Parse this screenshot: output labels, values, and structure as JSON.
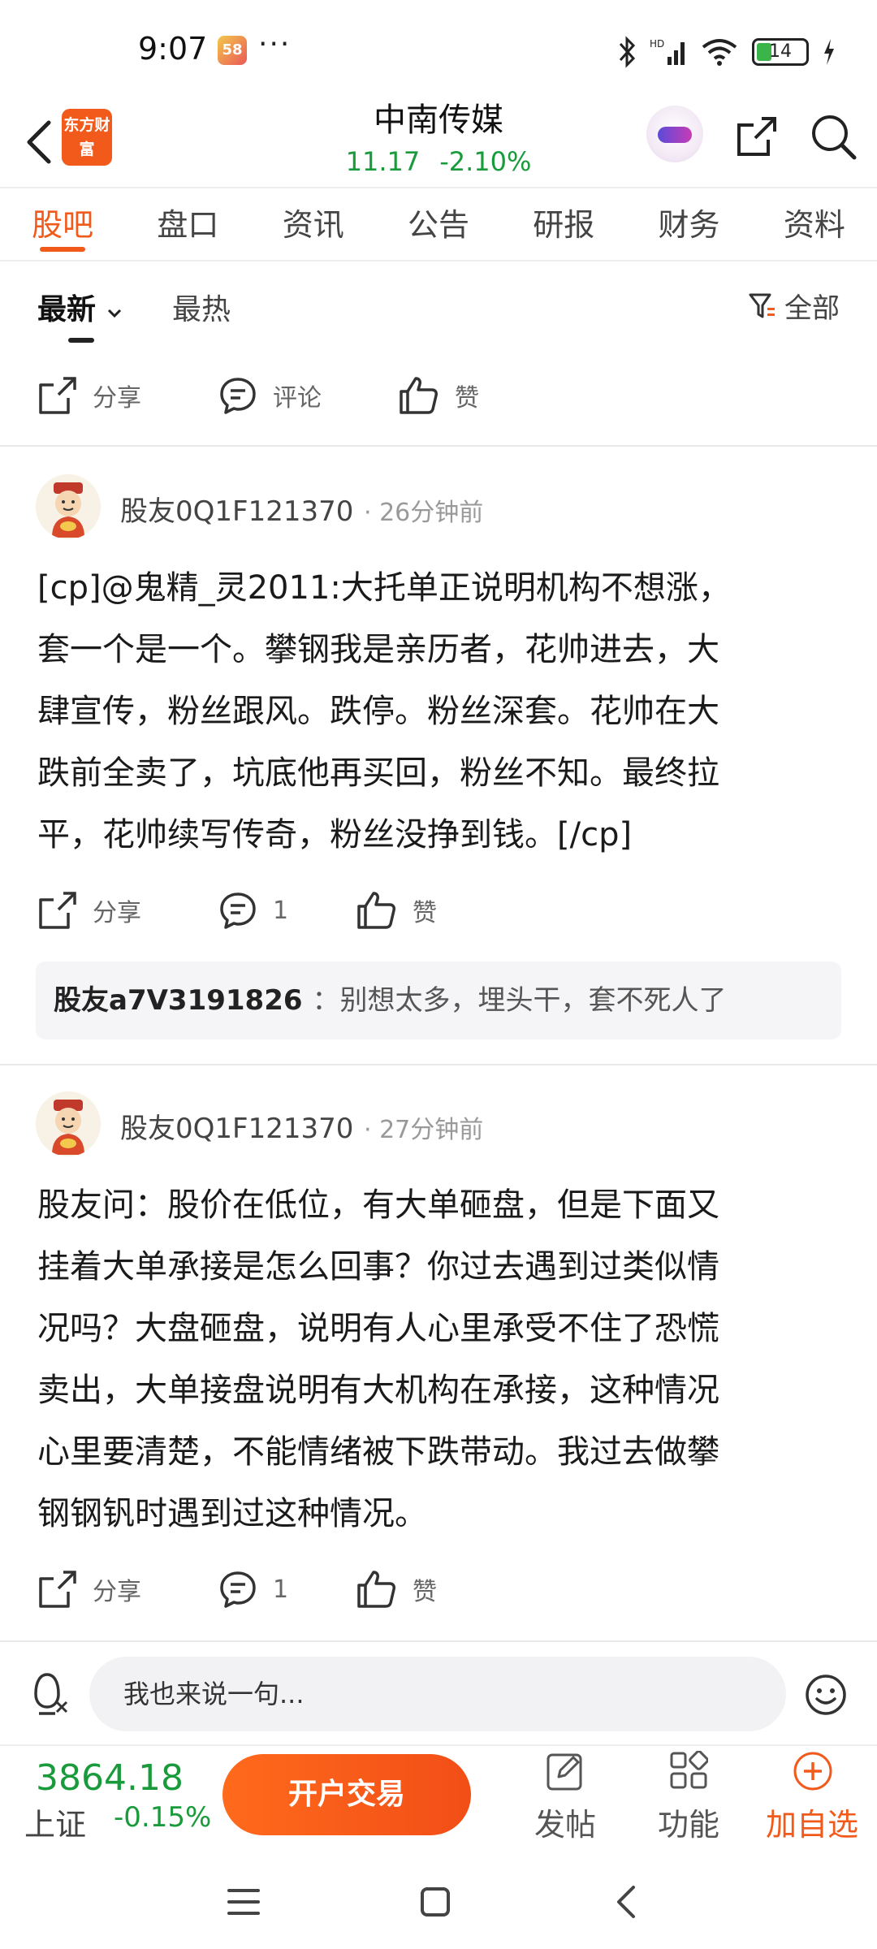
{
  "status_bar": {
    "time": "9:07",
    "app_badge": "58",
    "more": "···",
    "battery": "14"
  },
  "header": {
    "logo_text": "东方财富",
    "stock_name": "中南传媒",
    "price": "11.17",
    "change_pct": "-2.10%"
  },
  "tabs": [
    {
      "label": "股吧",
      "active": true
    },
    {
      "label": "盘口"
    },
    {
      "label": "资讯"
    },
    {
      "label": "公告"
    },
    {
      "label": "研报"
    },
    {
      "label": "财务"
    },
    {
      "label": "资料"
    }
  ],
  "sort": {
    "newest": "最新",
    "hottest": "最热",
    "filter": "全部"
  },
  "actions": {
    "share": "分享",
    "comment": "评论",
    "like": "赞"
  },
  "posts": [
    {
      "author": "股友0Q1F121370",
      "time": "26分钟前",
      "lines": [
        "[cp]@鬼精_灵2011:大托单正说明机构不想涨，",
        "套一个是一个。攀钢我是亲历者，花帅进去，大",
        "肆宣传，粉丝跟风。跌停。粉丝深套。花帅在大",
        "跌前全卖了，坑底他再买回，粉丝不知。最终拉",
        "平，花帅续写传奇，粉丝没挣到钱。[/cp]"
      ],
      "share": "分享",
      "comments": "1",
      "like": "赞",
      "reply": {
        "user": "股友a7V3191826",
        "text": "：别想太多，埋头干，套不死人了"
      }
    },
    {
      "author": "股友0Q1F121370",
      "time": "27分钟前",
      "lines": [
        "股友问：股价在低位，有大单砸盘，但是下面又",
        "挂着大单承接是怎么回事？你过去遇到过类似情",
        "况吗？大盘砸盘，说明有人心里承受不住了恐慌",
        "卖出，大单接盘说明有大机构在承接，这种情况",
        "心里要清楚，不能情绪被下跌带动。我过去做攀",
        "钢钢钒时遇到过这种情况。"
      ],
      "share": "分享",
      "comments": "1",
      "like": "赞"
    }
  ],
  "input": {
    "placeholder": "我也来说一句..."
  },
  "bottom": {
    "index_value": "3864.18",
    "index_name": "上证",
    "index_change": "-0.15%",
    "trade_button": "开户交易",
    "post": "发帖",
    "functions": "功能",
    "add_watch": "加自选"
  },
  "colors": {
    "accent": "#f25a1c",
    "down_green": "#1a9b3b"
  }
}
